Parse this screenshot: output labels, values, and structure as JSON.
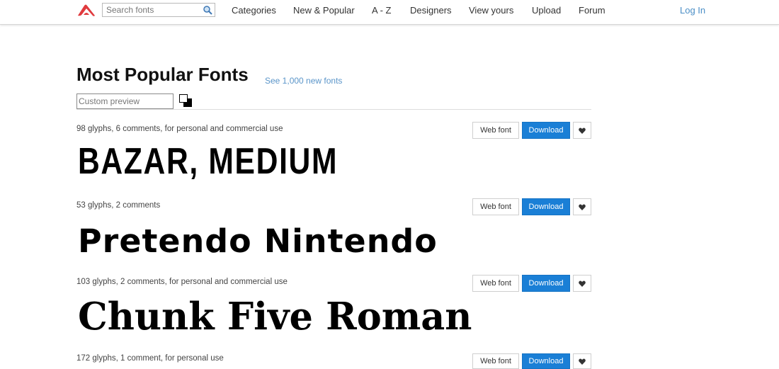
{
  "nav": {
    "search_placeholder": "Search fonts",
    "items": [
      "Categories",
      "New & Popular",
      "A - Z",
      "Designers",
      "View yours",
      "Upload",
      "Forum"
    ],
    "login": "Log In"
  },
  "page": {
    "title": "Most Popular Fonts",
    "new_fonts_link": "See 1,000 new fonts",
    "custom_preview_placeholder": "Custom preview"
  },
  "buttons": {
    "web_font": "Web font",
    "download": "Download"
  },
  "fonts": [
    {
      "meta": "98 glyphs, 6 comments, for personal and commercial use",
      "name": "BAZAR, MEDIUM"
    },
    {
      "meta": "53 glyphs, 2 comments",
      "name": "Pretendo Nintendo"
    },
    {
      "meta": "103 glyphs, 2 comments, for personal and commercial use",
      "name": "Chunk Five Roman"
    },
    {
      "meta": "172 glyphs, 1 comment, for personal use",
      "name": ""
    }
  ],
  "colors": {
    "accent": "#1a7fd6",
    "link": "#5a95c9",
    "logo": "#e03a3e"
  },
  "icons": [
    "logo-icon",
    "search-icon",
    "color-swap-icon",
    "heart-icon"
  ]
}
